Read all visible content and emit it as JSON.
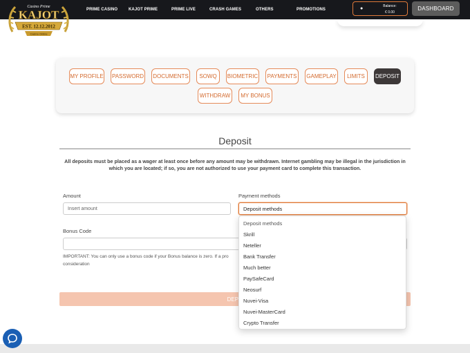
{
  "header": {
    "logo": {
      "top_text": "Casino Prime",
      "brand": "KAJOT",
      "est": "EST. 12.12.2012",
      "ribbon": "Casino Online"
    },
    "nav": [
      "PRIME CASINO",
      "KAJOT PRIME",
      "PRIME LIVE",
      "CRASH GAMES",
      "OTHERS",
      "PROMOTIONS"
    ],
    "balance_label": "Balance:",
    "balance_value": "€ 0.00",
    "dashboard_label": "DASHBOARD"
  },
  "tabs": [
    "MY PROFILE",
    "PASSWORD",
    "DOCUMENTS",
    "SOWQ",
    "BIOMETRIC",
    "PAYMENTS",
    "GAMEPLAY",
    "LIMITS",
    "DEPOSIT",
    "WITHDRAW",
    "MY BONUS"
  ],
  "active_tab": "DEPOSIT",
  "deposit": {
    "title": "Deposit",
    "notice": "All deposits must be placed as a wager at least once before any amount may be withdrawn. Internet gambling may be illegal in the jurisdiction in which you are located; if so, you are not authorized to use your payment card to complete this transaction.",
    "amount_label": "Amount",
    "amount_placeholder": "Insert amount",
    "payment_label": "Payment methods",
    "payment_selected": "Deposit methods",
    "bonus_label": "Bonus Code",
    "important_start": "IMPORTANT: You can only use a bonus code if your Bonus balance is zero. If a pro",
    "important_end": "consideration",
    "button_label": "DEPO"
  },
  "payment_options": [
    "Deposit methods",
    "Skrill",
    "Neteller",
    "Bank Transfer",
    "Much better",
    "PaySafeCard",
    "Neosurf",
    "Nuvei-Visa",
    "Nuvei-MasterCard",
    "Crypto Transfer"
  ],
  "colors": {
    "accent": "#e07a3a",
    "header_bg": "#17181c",
    "active_tab": "#3d3838",
    "chat": "#1a5fb4"
  }
}
